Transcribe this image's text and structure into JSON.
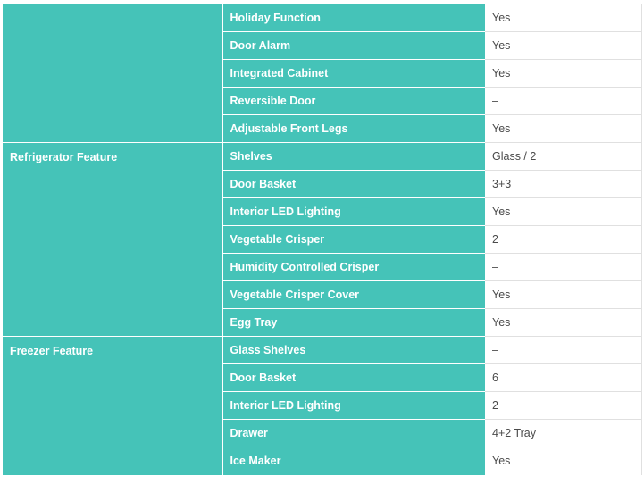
{
  "groups": [
    {
      "label": "",
      "rows": [
        {
          "feature": "Holiday Function",
          "value": "Yes"
        },
        {
          "feature": "Door Alarm",
          "value": "Yes"
        },
        {
          "feature": "Integrated Cabinet",
          "value": "Yes"
        },
        {
          "feature": "Reversible Door",
          "value": "–"
        },
        {
          "feature": "Adjustable Front Legs",
          "value": "Yes"
        }
      ]
    },
    {
      "label": "Refrigerator Feature",
      "rows": [
        {
          "feature": "Shelves",
          "value": "Glass / 2"
        },
        {
          "feature": "Door Basket",
          "value": "3+3"
        },
        {
          "feature": "Interior LED Lighting",
          "value": "Yes"
        },
        {
          "feature": "Vegetable Crisper",
          "value": "2"
        },
        {
          "feature": "Humidity Controlled Crisper",
          "value": "–"
        },
        {
          "feature": "Vegetable Crisper Cover",
          "value": "Yes"
        },
        {
          "feature": "Egg Tray",
          "value": "Yes"
        }
      ]
    },
    {
      "label": "Freezer Feature",
      "rows": [
        {
          "feature": "Glass Shelves",
          "value": "–"
        },
        {
          "feature": "Door Basket",
          "value": "6"
        },
        {
          "feature": "Interior LED Lighting",
          "value": "2"
        },
        {
          "feature": "Drawer",
          "value": "4+2 Tray"
        },
        {
          "feature": "Ice Maker",
          "value": "Yes"
        }
      ]
    }
  ],
  "colors": {
    "teal": "#45c3b8",
    "value_text": "#4a4a4a",
    "white": "#ffffff"
  }
}
